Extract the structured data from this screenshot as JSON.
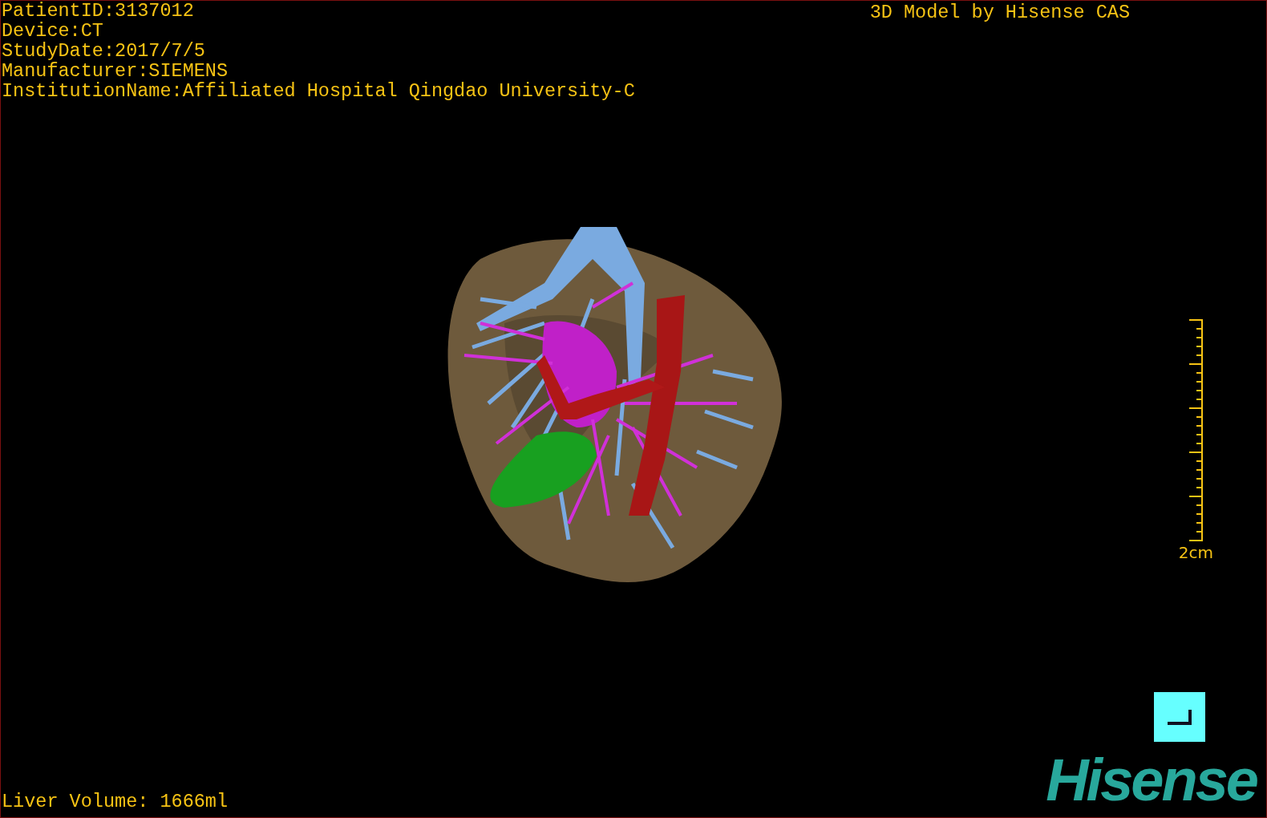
{
  "patient_info": [
    "PatientID:3137012",
    "Device:CT",
    "StudyDate:2017/7/5",
    "Manufacturer:SIEMENS",
    "InstitutionName:Affiliated Hospital Qingdao University-C"
  ],
  "caption": "3D Model by Hisense CAS",
  "scale_bar": {
    "label": "2cm"
  },
  "volume": "Liver Volume: 1666ml",
  "logo": "Hisense"
}
